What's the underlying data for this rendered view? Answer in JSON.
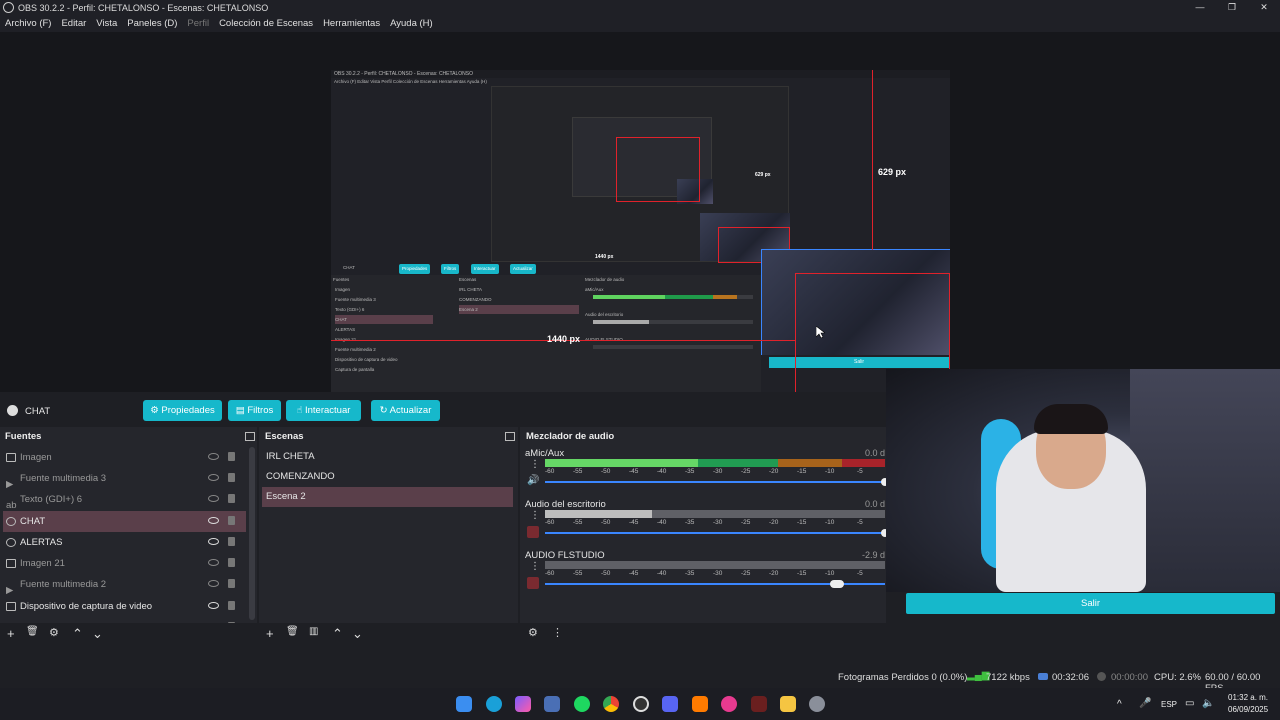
{
  "window": {
    "title": "OBS 30.2.2 - Perfil: CHETALONSO - Escenas: CHETALONSO",
    "controls": [
      "—",
      "❐",
      "✕"
    ]
  },
  "menu": [
    "Archivo (F)",
    "Editar",
    "Vista",
    "Paneles (D)",
    "Perfil",
    "Colección de Escenas",
    "Herramientas",
    "Ayuda (H)"
  ],
  "preview": {
    "inner_title": "OBS 30.2.2 - Perfil: CHETALONSO - Escenas: CHETALONSO",
    "inner_menu": "Archivo (F)  Editar  Vista  Perfil  Colección de Escenas  Herramientas  Ayuda (H)",
    "inner_buttons": [
      "Propiedades",
      "Filtros",
      "Interactuar",
      "Actualizar"
    ],
    "inner_source": "CHAT",
    "inner_headers": [
      "Fuentes",
      "Escenas",
      "Mezclador de audio"
    ],
    "inner_sources": [
      "Imagen",
      "Fuente multimedia 3",
      "Texto (GDI+) 6",
      "CHAT",
      "ALERTAS",
      "Imagen 21",
      "Fuente multimedia 2",
      "Dispositivo de captura de video",
      "Captura de pantalla"
    ],
    "inner_scenes": [
      "IRL CHETA",
      "COMENZANDO",
      "Escena 2"
    ],
    "inner_tracks": [
      "aMic/Aux",
      "Audio del escritorio",
      "AUDIO FLSTUDIO"
    ],
    "measure_height": "629 px",
    "measure_width": "1440 px",
    "measure_small": "629 px",
    "measure_small_w": "1440 px",
    "inner_salir": "Salir",
    "inner_status": "Fotogramas Perdidos 0 (0.0%)   7122 kbps   00:32:06   CPU: 2.6%   60.00 / 60.00 FPS"
  },
  "source_toolbar": {
    "source_name": "CHAT",
    "buttons": {
      "properties": "Propiedades",
      "filters": "Filtros",
      "interact": "Interactuar",
      "refresh": "Actualizar"
    }
  },
  "sources_dock": {
    "title": "Fuentes",
    "items": [
      {
        "label": "Imagen",
        "visible": false
      },
      {
        "label": "Fuente multimedia 3",
        "visible": false
      },
      {
        "label": "Texto (GDI+) 6",
        "visible": false
      },
      {
        "label": "CHAT",
        "visible": true
      },
      {
        "label": "ALERTAS",
        "visible": true
      },
      {
        "label": "Imagen 21",
        "visible": false
      },
      {
        "label": "Fuente multimedia 2",
        "visible": false
      },
      {
        "label": "Dispositivo de captura de video",
        "visible": true
      },
      {
        "label": "Captura de pantalla",
        "visible": true
      }
    ],
    "footer": [
      "+",
      "🗑",
      "⚙",
      "⌃",
      "⌄"
    ]
  },
  "scenes_dock": {
    "title": "Escenas",
    "items": [
      "IRL CHETA",
      "COMENZANDO",
      "Escena 2"
    ],
    "footer": [
      "+",
      "🗑",
      "▥",
      "⌃",
      "⌄"
    ]
  },
  "mixer_dock": {
    "title": "Mezclador de audio",
    "scale": [
      "-60",
      "-55",
      "-50",
      "-45",
      "-40",
      "-35",
      "-30",
      "-25",
      "-20",
      "-15",
      "-10",
      "-5"
    ],
    "tracks": [
      {
        "name": "aMic/Aux",
        "db": "0.0 d",
        "fader": 1.0
      },
      {
        "name": "Audio del escritorio",
        "db": "0.0 d",
        "fader": 1.0
      },
      {
        "name": "AUDIO FLSTUDIO",
        "db": "-2.9 d",
        "fader": 0.86
      }
    ]
  },
  "webcam": {
    "button": "Salir"
  },
  "status": {
    "dropped": "Fotogramas Perdidos 0 (0.0%)",
    "bitrate": "7122 kbps",
    "stream_time": "00:32:06",
    "rec_time": "00:00:00",
    "cpu": "CPU: 2.6%",
    "fps": "60.00 / 60.00 FPS"
  },
  "taskbar": {
    "lang": "ESP",
    "time": "01:32 a. m.",
    "date": "06/09/2025"
  },
  "colors": {
    "accent": "#16b8cb",
    "selected": "#5a3f4a",
    "meter_green": "#5fd35f",
    "meter_dark_green": "#1f9a4a",
    "meter_orange": "#b8741f",
    "meter_red": "#c2262b"
  }
}
